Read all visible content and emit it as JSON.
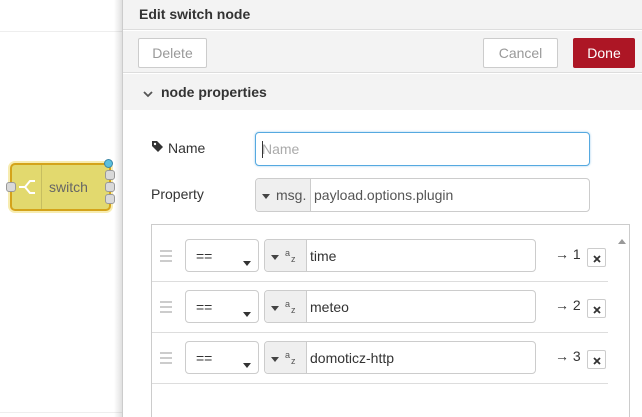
{
  "workspace": {
    "node": {
      "label": "switch"
    }
  },
  "tray": {
    "title": "Edit switch node",
    "buttons": {
      "delete": "Delete",
      "cancel": "Cancel",
      "done": "Done"
    },
    "section": {
      "label": "node properties"
    },
    "form": {
      "name_label": "Name",
      "name_placeholder": "Name",
      "name_value": "",
      "property_label": "Property",
      "property_prefix": "msg.",
      "property_value": "payload.options.plugin"
    },
    "rules": [
      {
        "operator": "==",
        "value": "time",
        "output": "→ 1"
      },
      {
        "operator": "==",
        "value": "meteo",
        "output": "→ 2"
      },
      {
        "operator": "==",
        "value": "domoticz-http",
        "output": "→ 3"
      }
    ]
  },
  "colors": {
    "done_button": "#ad1625",
    "node_fill": "#e2d96e",
    "node_border": "#d4a31a",
    "focus_border": "#56a9e0"
  },
  "icons": [
    "switch-node-icon",
    "tag-icon",
    "chevron-down-icon",
    "caret-down-icon",
    "az-string-icon",
    "drag-handle-icon",
    "close-icon",
    "scroll-up-icon"
  ]
}
